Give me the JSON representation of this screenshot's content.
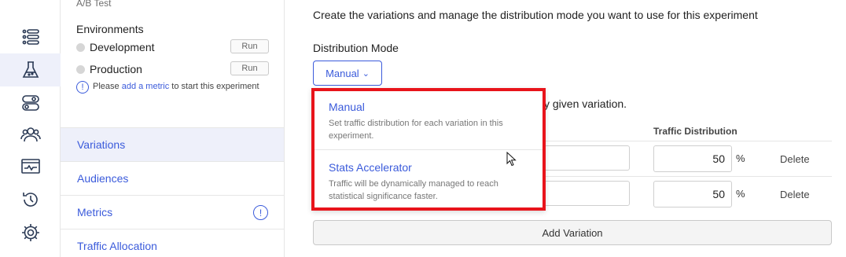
{
  "rail": {
    "icons": [
      "list-icon",
      "flask-icon",
      "toggle-icon",
      "users-icon",
      "monitor-chart-icon",
      "history-icon",
      "gear-icon"
    ],
    "active_index": 1
  },
  "sidebar": {
    "experiment_type": "A/B Test",
    "environments_title": "Environments",
    "environments": [
      {
        "name": "Development",
        "action": "Run"
      },
      {
        "name": "Production",
        "action": "Run"
      }
    ],
    "info": {
      "prefix": "Please ",
      "link": "add a metric",
      "suffix": " to start this experiment"
    },
    "nav": [
      {
        "label": "Variations",
        "active": true
      },
      {
        "label": "Audiences"
      },
      {
        "label": "Metrics",
        "warning": "!"
      },
      {
        "label": "Traffic Allocation"
      }
    ]
  },
  "main": {
    "intro": "Create the variations and manage the distribution mode you want to use for this experiment",
    "distribution_mode_label": "Distribution Mode",
    "distribution_mode_value": "Manual",
    "partial_text": "y given variation.",
    "traffic_header": "Traffic Distribution",
    "rows": [
      {
        "traffic": "50",
        "unit": "%",
        "action": "Delete"
      },
      {
        "traffic": "50",
        "unit": "%",
        "action": "Delete"
      }
    ],
    "add_variation": "Add Variation"
  },
  "dropdown": {
    "options": [
      {
        "title": "Manual",
        "description": "Set traffic distribution for each variation in this experiment."
      },
      {
        "title": "Stats Accelerator",
        "description": "Traffic will be dynamically managed to reach statistical significance faster."
      }
    ],
    "highlight_color": "#e8141b"
  },
  "colors": {
    "accent": "#3b5bdb",
    "active_bg": "#eef0fa"
  }
}
